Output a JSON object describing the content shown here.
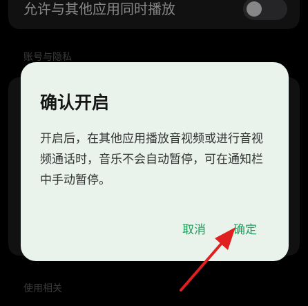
{
  "settings": {
    "allow_simultaneous_label": "允许与其他应用同时播放",
    "allow_simultaneous_enabled": false,
    "section_account_label": "账号与隐私",
    "section_usage_label": "使用相关"
  },
  "dialog": {
    "title": "确认开启",
    "message": "开启后，在其他应用播放音视频或进行音视频通话时，音乐不会自动暂停，可在通知栏中手动暂停。",
    "cancel_label": "取消",
    "confirm_label": "确定"
  },
  "colors": {
    "accent": "#1f9d5c",
    "annotation_arrow": "#e02020",
    "dialog_bg": "#e9f3ec",
    "page_bg": "#000000"
  }
}
